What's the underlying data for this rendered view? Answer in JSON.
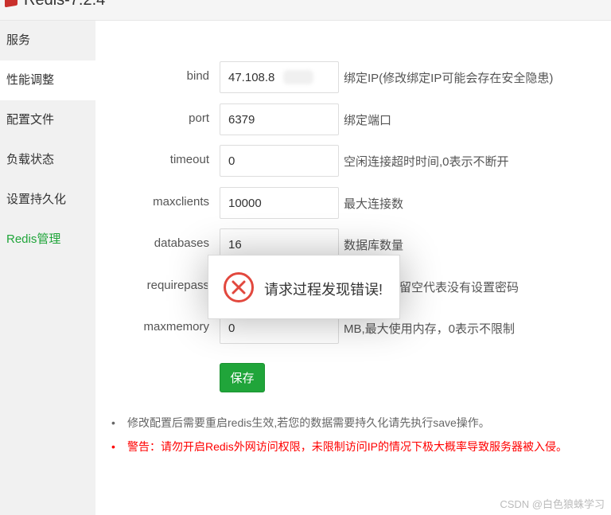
{
  "app": {
    "title": "Redis-7.2.4",
    "logo_icon": "redis-logo-icon"
  },
  "sidebar": {
    "items": [
      {
        "label": "服务",
        "active": false
      },
      {
        "label": "性能调整",
        "active": true
      },
      {
        "label": "配置文件",
        "active": false
      },
      {
        "label": "负载状态",
        "active": false
      },
      {
        "label": "设置持久化",
        "active": false
      },
      {
        "label": "Redis管理",
        "active": false,
        "color": "#20a53a"
      }
    ]
  },
  "form": {
    "bind": {
      "label": "bind",
      "value": "47.108.8",
      "hint": "绑定IP(修改绑定IP可能会存在安全隐患)"
    },
    "port": {
      "label": "port",
      "value": "6379",
      "hint": "绑定端口"
    },
    "timeout": {
      "label": "timeout",
      "value": "0",
      "hint": "空闲连接超时时间,0表示不断开"
    },
    "maxclients": {
      "label": "maxclients",
      "value": "10000",
      "hint": "最大连接数"
    },
    "databases": {
      "label": "databases",
      "value": "16",
      "hint": "数据库数量"
    },
    "requirepass": {
      "label": "requirepass",
      "value": "",
      "hint": "留空代表没有设置密码"
    },
    "maxmemory": {
      "label": "maxmemory",
      "value": "0",
      "hint": "MB,最大使用内存，0表示不限制"
    },
    "save_label": "保存"
  },
  "notes": {
    "bullet": "•",
    "info": "修改配置后需要重启redis生效,若您的数据需要持久化请先执行save操作。",
    "warning": "警告：请勿开启Redis外网访问权限，未限制访问IP的情况下极大概率导致服务器被入侵。"
  },
  "toast": {
    "message": "请求过程发现错误!",
    "icon": "error-circle-icon"
  },
  "colors": {
    "accent": "#20a53a",
    "warning": "#ff0000",
    "error": "#e2483e"
  },
  "watermark": "CSDN @白色狼蛛学习"
}
